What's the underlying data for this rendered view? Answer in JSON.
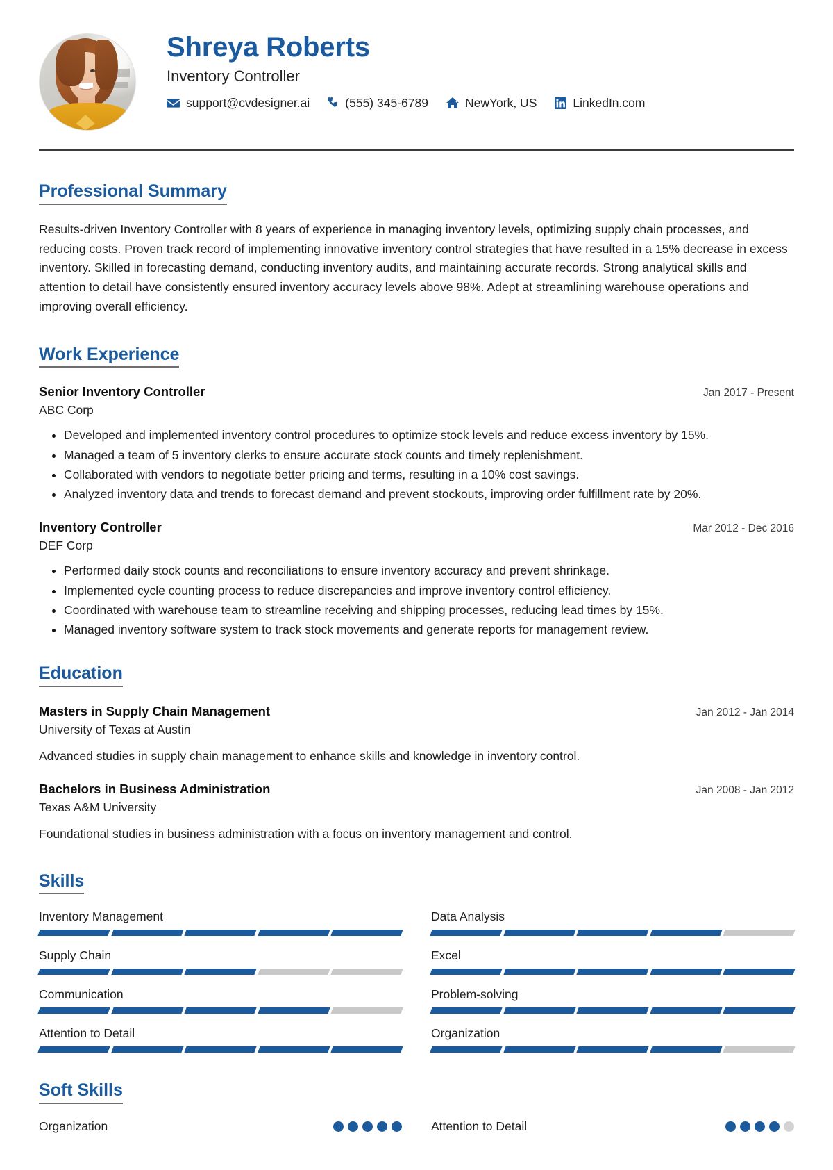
{
  "theme": {
    "accent": "#1b5a9c",
    "text": "#1f1f1f",
    "muted": "#c9c9c9",
    "rule": "#3a3a3a"
  },
  "header": {
    "name": "Shreya Roberts",
    "job_title": "Inventory Controller",
    "avatar_alt": "profile-photo",
    "contacts": [
      {
        "icon": "envelope-icon",
        "value": "support@cvdesigner.ai"
      },
      {
        "icon": "phone-icon",
        "value": "(555) 345-6789"
      },
      {
        "icon": "home-icon",
        "value": "NewYork, US"
      },
      {
        "icon": "linkedin-icon",
        "value": "LinkedIn.com"
      }
    ]
  },
  "sections": {
    "summary": {
      "title": "Professional Summary",
      "body": "Results-driven Inventory Controller with 8 years of experience in managing inventory levels, optimizing supply chain processes, and reducing costs. Proven track record of implementing innovative inventory control strategies that have resulted in a 15% decrease in excess inventory. Skilled in forecasting demand, conducting inventory audits, and maintaining accurate records. Strong analytical skills and attention to detail have consistently ensured inventory accuracy levels above 98%. Adept at streamlining warehouse operations and improving overall efficiency."
    },
    "work": {
      "title": "Work Experience",
      "entries": [
        {
          "role": "Senior Inventory Controller",
          "organization": "ABC Corp",
          "dates": "Jan 2017 - Present",
          "bullets": [
            "Developed and implemented inventory control procedures to optimize stock levels and reduce excess inventory by 15%.",
            "Managed a team of 5 inventory clerks to ensure accurate stock counts and timely replenishment.",
            "Collaborated with vendors to negotiate better pricing and terms, resulting in a 10% cost savings.",
            "Analyzed inventory data and trends to forecast demand and prevent stockouts, improving order fulfillment rate by 20%."
          ]
        },
        {
          "role": "Inventory Controller",
          "organization": "DEF Corp",
          "dates": "Mar 2012 - Dec 2016",
          "bullets": [
            "Performed daily stock counts and reconciliations to ensure inventory accuracy and prevent shrinkage.",
            "Implemented cycle counting process to reduce discrepancies and improve inventory control efficiency.",
            "Coordinated with warehouse team to streamline receiving and shipping processes, reducing lead times by 15%.",
            "Managed inventory software system to track stock movements and generate reports for management review."
          ]
        }
      ]
    },
    "education": {
      "title": "Education",
      "entries": [
        {
          "degree": "Masters in Supply Chain Management",
          "school": "University of Texas at Austin",
          "dates": "Jan 2012 - Jan 2014",
          "description": "Advanced studies in supply chain management to enhance skills and knowledge in inventory control."
        },
        {
          "degree": "Bachelors in Business Administration",
          "school": "Texas A&M University",
          "dates": "Jan 2008 - Jan 2012",
          "description": "Foundational studies in business administration with a focus on inventory management and control."
        }
      ]
    },
    "skills": {
      "title": "Skills",
      "max_level": 5,
      "items": [
        {
          "name": "Inventory Management",
          "level": 5
        },
        {
          "name": "Data Analysis",
          "level": 4
        },
        {
          "name": "Supply Chain",
          "level": 3
        },
        {
          "name": "Excel",
          "level": 5
        },
        {
          "name": "Communication",
          "level": 4
        },
        {
          "name": "Problem-solving",
          "level": 5
        },
        {
          "name": "Attention to Detail",
          "level": 5
        },
        {
          "name": "Organization",
          "level": 4
        }
      ]
    },
    "soft_skills": {
      "title": "Soft Skills",
      "max_level": 5,
      "items": [
        {
          "name": "Organization",
          "level": 5
        },
        {
          "name": "Attention to Detail",
          "level": 4
        }
      ]
    }
  }
}
